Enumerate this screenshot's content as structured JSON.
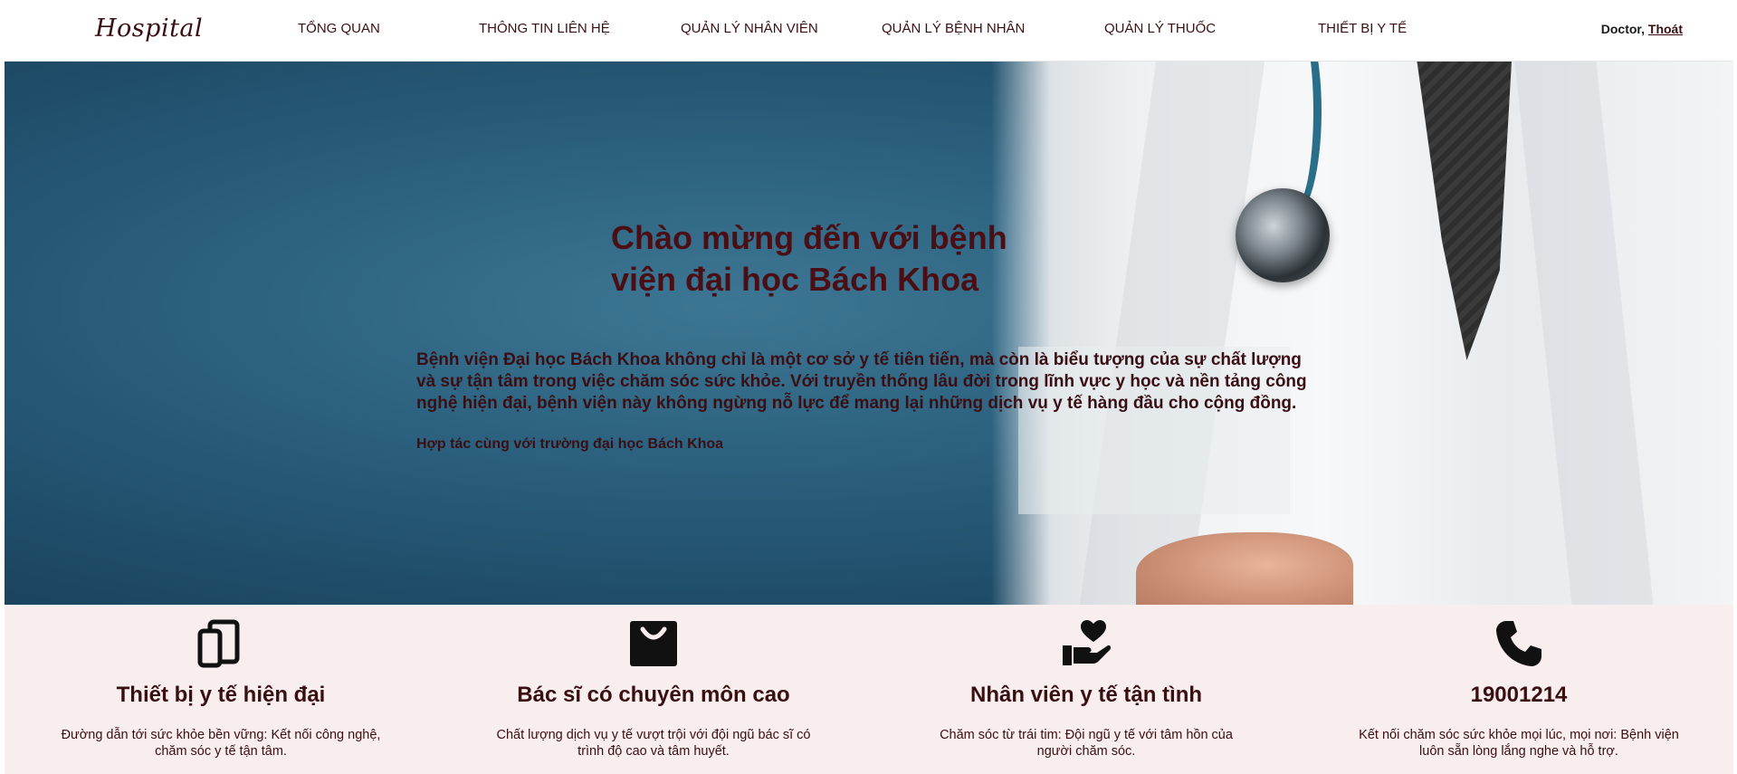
{
  "header": {
    "brand": "Hospital",
    "nav": [
      {
        "label": "TỔNG QUAN"
      },
      {
        "label": "THÔNG TIN LIÊN HỆ"
      },
      {
        "label": "QUẢN LÝ NHÂN VIÊN"
      },
      {
        "label": "QUẢN LÝ BỆNH NHÂN"
      },
      {
        "label": "QUẢN LÝ THUỐC"
      },
      {
        "label": "THIẾT BỊ Y TẾ"
      }
    ],
    "user_label": "Doctor,",
    "logout_label": "Thoát"
  },
  "hero": {
    "title": "Chào mừng đến với bệnh viện đại học Bách Khoa",
    "description": "Bệnh viện Đại học Bách Khoa không chỉ là một cơ sở y tế tiên tiến, mà còn là biểu tượng của sự chất lượng và sự tận tâm trong việc chăm sóc sức khỏe. Với truyền thống lâu đời trong lĩnh vực y học và nền tảng công nghệ hiện đại, bệnh viện này không ngừng nỗ lực để mang lại những dịch vụ y tế hàng đầu cho cộng đồng.",
    "subtitle": "Hợp tác cùng với trường đại học Bách Khoa"
  },
  "features": [
    {
      "icon": "tablet-icon",
      "title": "Thiết bị y tế hiện đại",
      "description": "Đường dẫn tới sức khỏe bền vững: Kết nối công nghệ, chăm sóc y tế tận tâm."
    },
    {
      "icon": "shopping-bag-icon",
      "title": "Bác sĩ có chuyên môn cao",
      "description": "Chất lượng dịch vụ y tế vượt trội với đội ngũ bác sĩ có trình độ cao và tâm huyết."
    },
    {
      "icon": "hand-heart-icon",
      "title": "Nhân viên y tế tận tình",
      "description": "Chăm sóc từ trái tim: Đội ngũ y tế với tâm hồn của người chăm sóc."
    },
    {
      "icon": "phone-icon",
      "title": "19001214",
      "description": "Kết nối chăm sóc sức khỏe mọi lúc, mọi nơi: Bệnh viện luôn sẵn lòng lắng nghe và hỗ trợ."
    }
  ],
  "colors": {
    "brand_text": "#3a0f12",
    "hero_blue": "#2c6280",
    "feature_bg": "#f8eeee"
  }
}
